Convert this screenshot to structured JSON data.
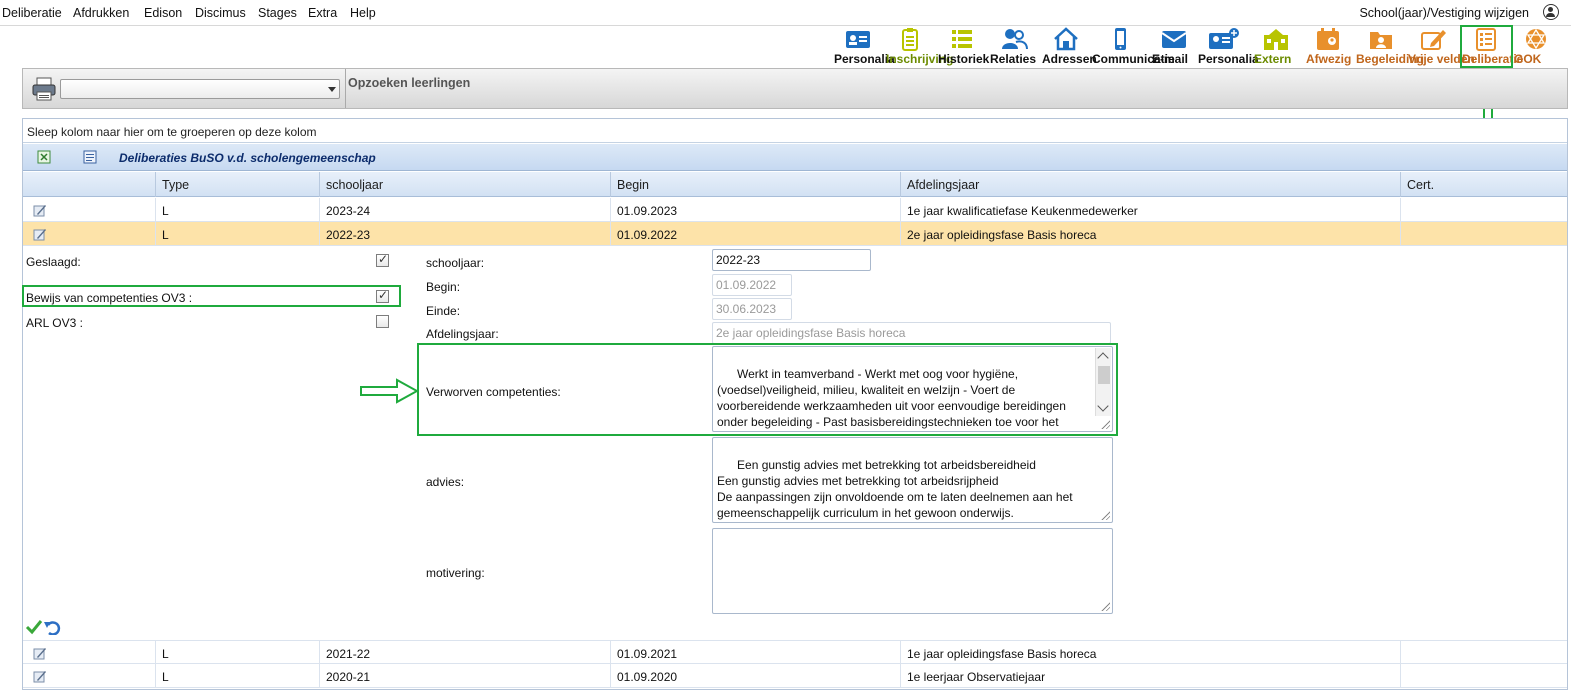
{
  "menu": {
    "items": [
      "Deliberatie",
      "Afdrukken",
      "Edison",
      "Discimus",
      "Stages",
      "Extra",
      "Help"
    ],
    "right_label": "School(jaar)/Vestiging wijzigen"
  },
  "toolbar": {
    "buttons": [
      {
        "label": "Personalia",
        "icon": "id-card-icon"
      },
      {
        "label": "Inschrijving",
        "icon": "clipboard-icon"
      },
      {
        "label": "Historiek",
        "icon": "list-icon"
      },
      {
        "label": "Relaties",
        "icon": "people-icon"
      },
      {
        "label": "Adressen",
        "icon": "house-icon"
      },
      {
        "label": "Communicatie",
        "icon": "phone-icon"
      },
      {
        "label": "E-mail",
        "icon": "envelope-icon"
      },
      {
        "label": "Personalia",
        "icon": "id-card-plus-icon"
      },
      {
        "label": "Extern",
        "icon": "school-building-icon"
      },
      {
        "label": "Afwezig",
        "icon": "calendar-person-icon"
      },
      {
        "label": "Begeleiding",
        "icon": "folder-person-icon"
      },
      {
        "label": "Vrije velden",
        "icon": "edit-pencil-icon"
      },
      {
        "label": "Deliberatie",
        "icon": "checklist-icon"
      },
      {
        "label": "GOK",
        "icon": "globe-network-icon"
      }
    ]
  },
  "search": {
    "title": "Opzoeken leerlingen",
    "combo_value": ""
  },
  "grid": {
    "group_hint": "Sleep kolom naar hier om te groeperen op deze kolom",
    "title": "Deliberaties BuSO v.d. scholengemeenschap",
    "columns": [
      "",
      "Type",
      "schooljaar",
      "Begin",
      "Afdelingsjaar",
      "Cert."
    ],
    "rows": [
      {
        "type": "L",
        "schooljaar": "2023-24",
        "begin": "01.09.2023",
        "afdelingsjaar": "1e jaar kwalificatiefase Keukenmedewerker",
        "cert": ""
      },
      {
        "type": "L",
        "schooljaar": "2022-23",
        "begin": "01.09.2022",
        "afdelingsjaar": "2e jaar opleidingsfase Basis horeca",
        "cert": ""
      },
      {
        "type": "L",
        "schooljaar": "2021-22",
        "begin": "01.09.2021",
        "afdelingsjaar": "1e jaar opleidingsfase Basis horeca",
        "cert": ""
      },
      {
        "type": "L",
        "schooljaar": "2020-21",
        "begin": "01.09.2020",
        "afdelingsjaar": "1e leerjaar Observatiejaar",
        "cert": ""
      }
    ]
  },
  "detail": {
    "geslaagd_label": "Geslaagd:",
    "geslaagd_checked": true,
    "bewijs_label": "Bewijs van competenties OV3 :",
    "bewijs_checked": true,
    "arl_label": "ARL OV3 :",
    "arl_checked": false,
    "schooljaar_label": "schooljaar:",
    "schooljaar_value": "2022-23",
    "begin_label": "Begin:",
    "begin_value": "01.09.2022",
    "einde_label": "Einde:",
    "einde_value": "30.06.2023",
    "afdelingsjaar_label": "Afdelingsjaar:",
    "afdelingsjaar_value": "2e jaar opleidingsfase Basis horeca",
    "competenties_label": "Verworven competenties:",
    "competenties_value": "Werkt in teamverband - Werkt met oog voor hygiëne,\n(voedsel)veiligheid, milieu, kwaliteit en welzijn - Voert de\nvoorbereidende werkzaamheden uit voor eenvoudige bereidingen\nonder begeleiding - Past basisbereidingstechnieken toe voor het\nbereiden van eenvoudige warme en koude gerechten onder",
    "advies_label": "advies:",
    "advies_value": "Een gunstig advies met betrekking tot arbeidsbereidheid\nEen gunstig advies met betrekking tot arbeidsrijpheid\nDe aanpassingen zijn onvoldoende om te laten deelnemen aan het\ngemeenschappelijk curriculum in het gewoon onderwijs.",
    "motivering_label": "motivering:",
    "motivering_value": ""
  },
  "colors": {
    "highlight": "#1faa3d",
    "selected_row": "#fde3a9",
    "icon_blue": "#1e6fc0",
    "icon_orange": "#e8902c",
    "icon_yellow": "#b8c400"
  }
}
